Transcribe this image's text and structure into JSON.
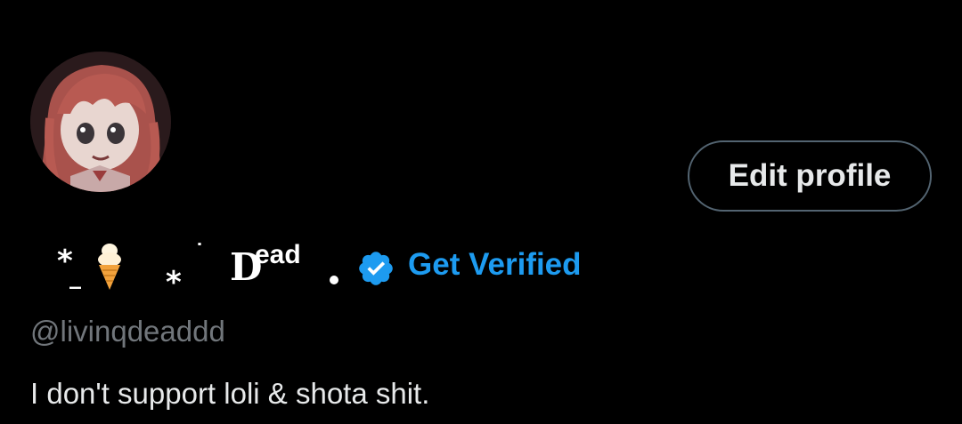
{
  "profile": {
    "display_name": {
      "deco_star": "*",
      "deco_underscore": "_",
      "deco_star2": "*",
      "deco_dot": "˙",
      "name_initial": "D",
      "name_rest": "ead"
    },
    "get_verified_label": "Get Verified",
    "handle": "@livinqdeaddd",
    "bio": "I don't support loli & shota shit."
  },
  "actions": {
    "edit_profile_label": "Edit profile"
  },
  "colors": {
    "background": "#000000",
    "accent": "#1d9bf0",
    "muted": "#71767b",
    "button_border": "#536471"
  },
  "icons": {
    "avatar": "anime-girl-avatar",
    "verified": "verified-badge-icon",
    "emoji": "ice-cream-icon"
  }
}
